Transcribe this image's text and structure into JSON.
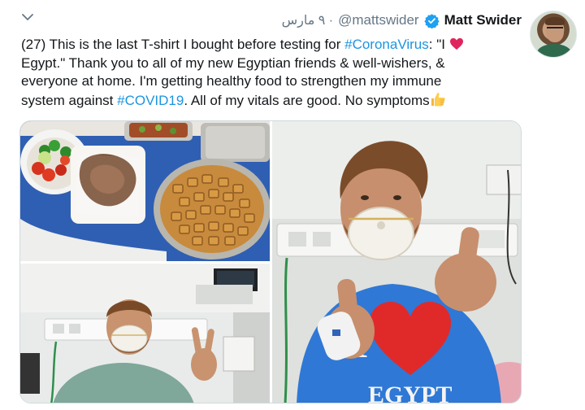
{
  "tweet": {
    "display_name": "Matt Swider",
    "handle": "@mattswider",
    "date": "٩ مارس ·",
    "text": {
      "line1_prefix": "(27) This is the last T-shirt I bought before testing for ",
      "hashtag_corona": "#CoronaVirus",
      "line1_suffix": ": \"I ",
      "line2": "Egypt.\" Thank you to all of my new Egyptian friends & well-wishers, &",
      "line3": "everyone at home. I'm getting healthy food to strengthen my immune",
      "line4_prefix": "system against ",
      "hashtag_covid": "#COVID19",
      "line4_suffix": ". All of my vitals are good. No symptoms"
    }
  },
  "media": {
    "shirt_text_i": "I",
    "shirt_text_egypt": "EGYPT"
  },
  "icons": {
    "menu": "chevron-down-icon",
    "verified": "verified-badge-icon",
    "heart": "red-heart-emoji",
    "thumb": "thumbs-up-emoji"
  },
  "colors": {
    "link": "#1b95e0",
    "verified": "#1da1f2",
    "secondary_text": "#657786",
    "heart": "#e0245e"
  }
}
